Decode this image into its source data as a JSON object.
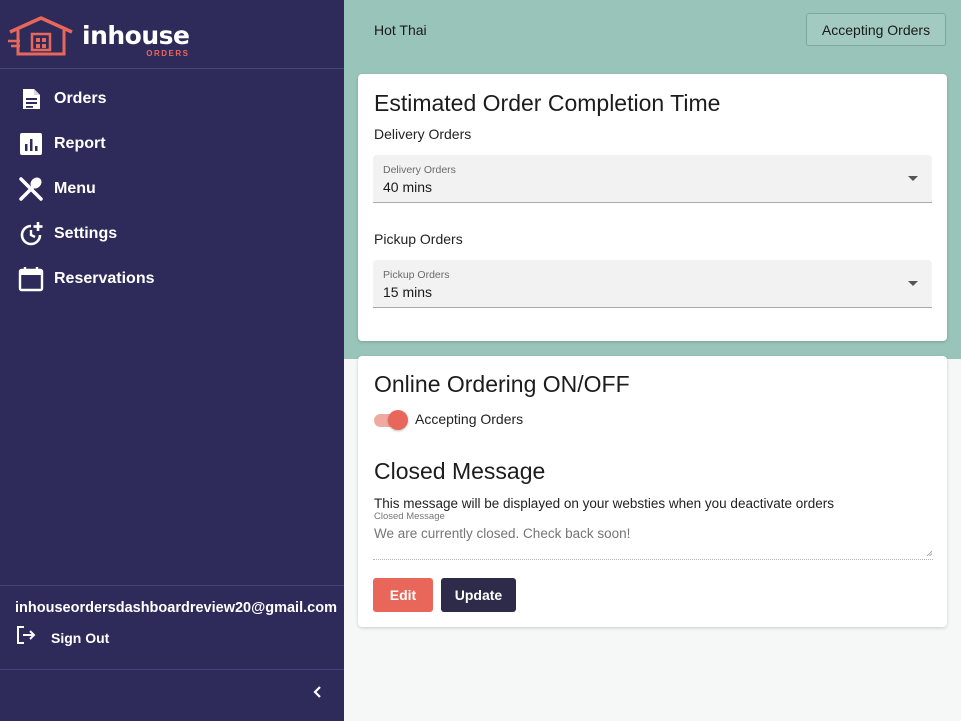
{
  "brand": {
    "name": "inhouse",
    "sub": "ORDERS"
  },
  "sidebar": {
    "items": [
      {
        "label": "Orders",
        "icon": "document-icon"
      },
      {
        "label": "Report",
        "icon": "bar-chart-icon"
      },
      {
        "label": "Menu",
        "icon": "utensils-icon"
      },
      {
        "label": "Settings",
        "icon": "clock-plus-icon"
      },
      {
        "label": "Reservations",
        "icon": "calendar-icon"
      }
    ],
    "email": "inhouseordersdashboardreview20@gmail.com",
    "sign_out": "Sign Out",
    "collapse_icon": "chevron-left-icon"
  },
  "header": {
    "restaurant": "Hot Thai",
    "status_button": "Accepting Orders"
  },
  "completion": {
    "title": "Estimated Order Completion Time",
    "delivery_heading": "Delivery Orders",
    "delivery_label": "Delivery Orders",
    "delivery_value": "40 mins",
    "pickup_heading": "Pickup Orders",
    "pickup_label": "Pickup Orders",
    "pickup_value": "15 mins"
  },
  "online_ordering": {
    "title": "Online Ordering ON/OFF",
    "toggle_label": "Accepting Orders",
    "toggle_on": true
  },
  "closed_message": {
    "title": "Closed Message",
    "description": "This message will be displayed on your websties when you deactivate orders",
    "field_label": "Closed Message",
    "placeholder": "We are currently closed. Check back soon!",
    "edit_label": "Edit",
    "update_label": "Update"
  },
  "colors": {
    "sidebar": "#2e2b5a",
    "header_band": "#99c4b9",
    "accent": "#e8675a",
    "dark_button": "#2e2b4a"
  }
}
